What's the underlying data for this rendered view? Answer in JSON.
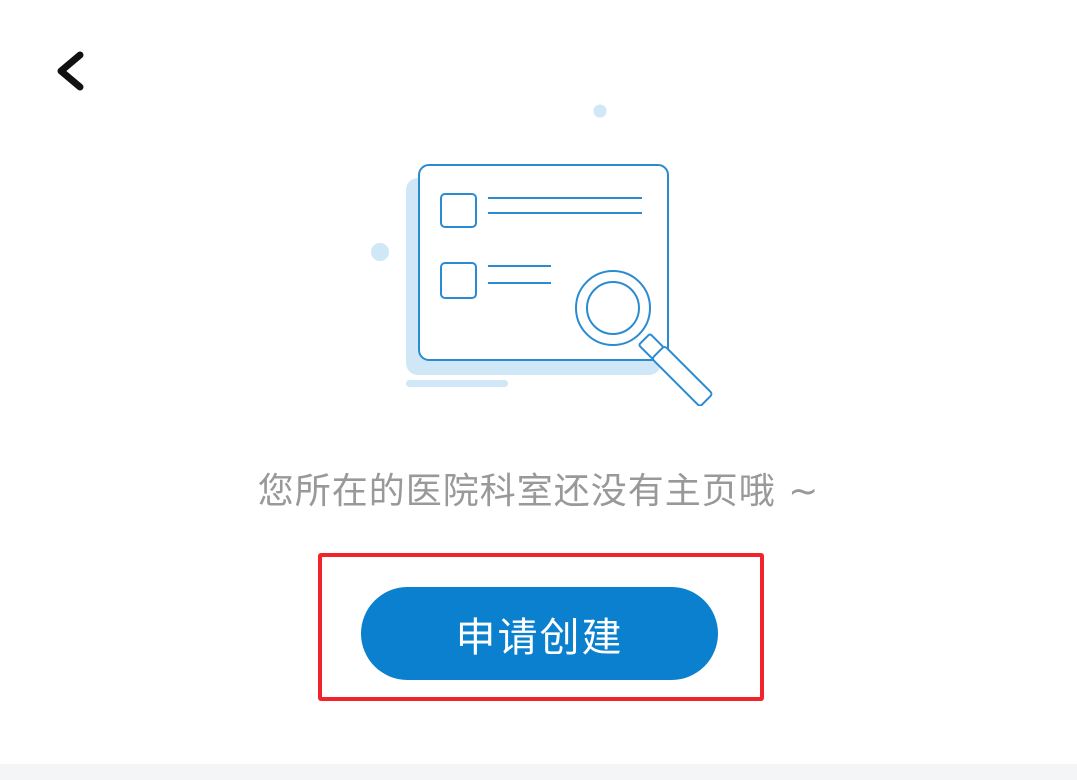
{
  "header": {
    "back_icon": "chevron-left-icon"
  },
  "empty_state": {
    "illustration_icon": "document-search-icon",
    "message": "您所在的医院科室还没有主页哦 ~",
    "action_label": "申请创建"
  },
  "colors": {
    "primary": "#0a80cf",
    "illustration_line": "#2a8bd0",
    "illustration_fill": "#cfe7f7",
    "message_text": "#999999",
    "highlight_border": "#f2232a"
  }
}
